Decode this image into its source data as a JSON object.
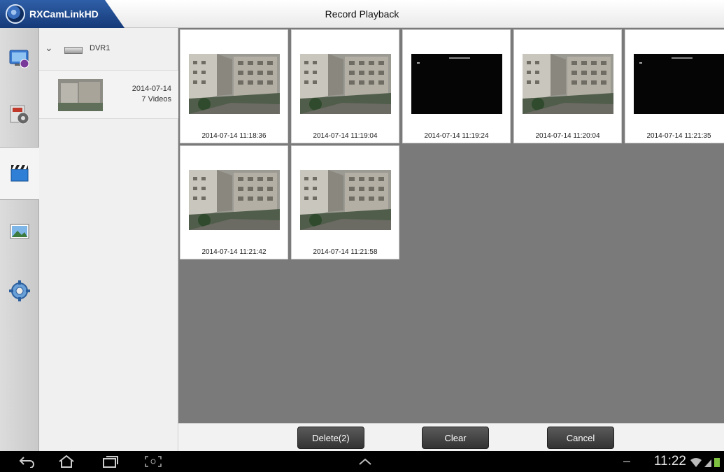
{
  "titlebar": {
    "app_name": "RXCamLinkHD",
    "page_title": "Record Playback"
  },
  "rail": {
    "items": [
      {
        "icon": "live-view-icon",
        "active": false
      },
      {
        "icon": "remote-playback-icon",
        "active": false
      },
      {
        "icon": "record-playback-icon",
        "active": true
      },
      {
        "icon": "image-gallery-icon",
        "active": false
      },
      {
        "icon": "settings-icon",
        "active": false
      }
    ]
  },
  "tree": {
    "device_name": "DVR1",
    "date": "2014-07-14",
    "count": "7 Videos"
  },
  "videos": [
    {
      "timestamp": "2014-07-14  11:18:36",
      "thumbnail": "camera-view"
    },
    {
      "timestamp": "2014-07-14  11:19:04",
      "thumbnail": "camera-view"
    },
    {
      "timestamp": "2014-07-14  11:19:24",
      "thumbnail": "black-screen"
    },
    {
      "timestamp": "2014-07-14  11:20:04",
      "thumbnail": "camera-view"
    },
    {
      "timestamp": "2014-07-14  11:21:35",
      "thumbnail": "black-screen"
    },
    {
      "timestamp": "2014-07-14  11:21:42",
      "thumbnail": "camera-view"
    },
    {
      "timestamp": "2014-07-14  11:21:58",
      "thumbnail": "camera-view"
    }
  ],
  "actions": {
    "delete_label": "Delete(2)",
    "clear_label": "Clear",
    "cancel_label": "Cancel"
  },
  "system_bar": {
    "dash": "–",
    "time": "11:22"
  },
  "colors": {
    "app_tab": "#1f4a8f",
    "content_bg": "#7a7a7a",
    "button": "#444444"
  }
}
